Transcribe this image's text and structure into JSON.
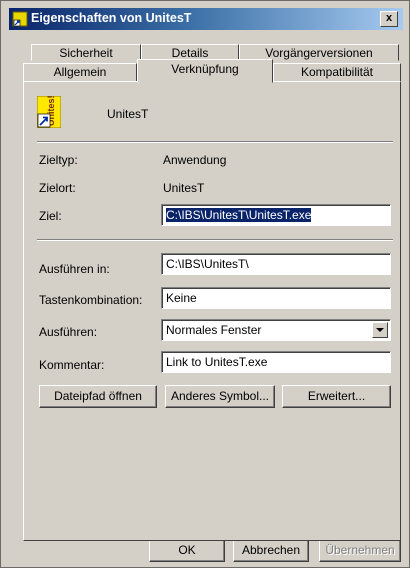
{
  "window": {
    "title": "Eigenschaften von UnitesT",
    "close_label": "x"
  },
  "tabs": {
    "row1": [
      "Sicherheit",
      "Details",
      "Vorgängerversionen"
    ],
    "row2": [
      "Allgemein",
      "Verknüpfung",
      "Kompatibilität"
    ],
    "active": "Verknüpfung"
  },
  "app": {
    "name": "UnitesT",
    "icon_text": "Unites!"
  },
  "info": {
    "zieltyp_label": "Zieltyp:",
    "zieltyp_value": "Anwendung",
    "zielort_label": "Zielort:",
    "zielort_value": "UnitesT",
    "ziel_label": "Ziel:",
    "ziel_value": "C:\\IBS\\UnitesT\\UnitesT.exe"
  },
  "fields": {
    "ausfuehren_in_label": "Ausführen in:",
    "ausfuehren_in_value": "C:\\IBS\\UnitesT\\",
    "tastenkombination_label": "Tastenkombination:",
    "tastenkombination_value": "Keine",
    "ausfuehren_label": "Ausführen:",
    "ausfuehren_value": "Normales Fenster",
    "kommentar_label": "Kommentar:",
    "kommentar_value": "Link to UnitesT.exe"
  },
  "buttons": {
    "dateipfad": "Dateipfad öffnen",
    "symbol": "Anderes Symbol...",
    "erweitert": "Erweitert...",
    "ok": "OK",
    "abbrechen": "Abbrechen",
    "uebernehmen": "Übernehmen"
  },
  "colors": {
    "titlebar_start": "#0a246a",
    "titlebar_end": "#a6caf0",
    "dialog_bg": "#d4d0c8",
    "selection": "#0a246a"
  }
}
